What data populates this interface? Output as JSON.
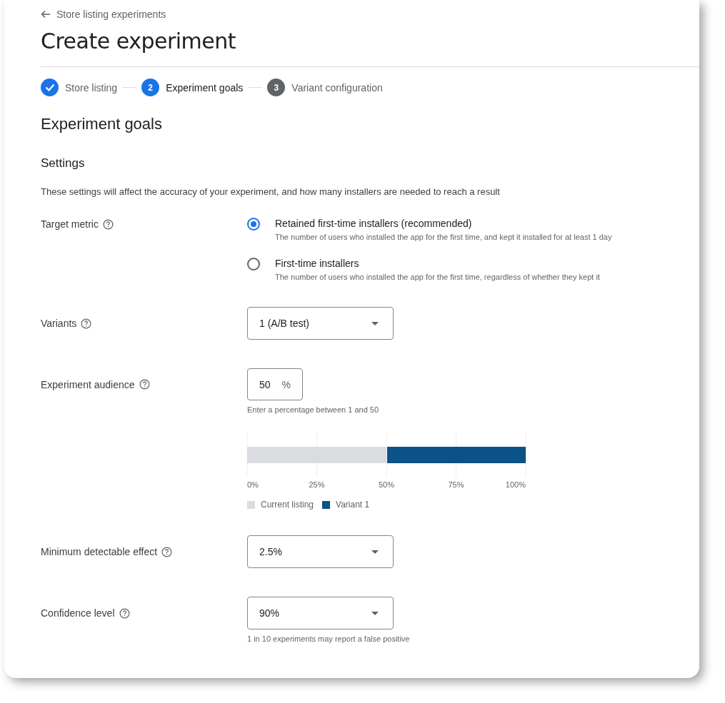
{
  "back_link": {
    "label": "Store listing experiments"
  },
  "title": "Create experiment",
  "stepper": [
    {
      "label": "Store listing",
      "completed": true,
      "selected": false
    },
    {
      "number": "2",
      "label": "Experiment goals",
      "completed": false,
      "selected": true
    },
    {
      "number": "3",
      "label": "Variant configuration",
      "completed": false,
      "selected": false
    }
  ],
  "section_title": "Experiment goals",
  "subsection_title": "Settings",
  "description": "These settings will affect the accuracy of your experiment, and how many installers are needed to reach a result",
  "target_metric": {
    "label": "Target metric",
    "options": [
      {
        "label": "Retained first-time installers (recommended)",
        "description": "The number of users who installed the app for the first time, and kept it installed for at least 1 day",
        "selected": true
      },
      {
        "label": "First-time installers",
        "description": "The number of users who installed the app for the first time, regardless of whether they kept it",
        "selected": false
      }
    ]
  },
  "variants": {
    "label": "Variants",
    "value": "1 (A/B test)"
  },
  "experiment_audience": {
    "label": "Experiment audience",
    "value": "50",
    "suffix": "%",
    "helper": "Enter a percentage between 1 and 50",
    "chart_data": {
      "type": "bar",
      "orientation": "horizontal",
      "stacked": true,
      "grid": true,
      "legend": true,
      "series": [
        {
          "name": "Current listing",
          "color": "#dadce0",
          "values": [
            50
          ]
        },
        {
          "name": "Variant 1",
          "color": "#0b5288",
          "values": [
            50
          ]
        }
      ],
      "xlim": [
        0,
        100
      ],
      "xticks": [
        {
          "value": 0,
          "label": "0%"
        },
        {
          "value": 25,
          "label": "25%"
        },
        {
          "value": 50,
          "label": "50%"
        },
        {
          "value": 75,
          "label": "75%"
        },
        {
          "value": 100,
          "label": "100%"
        }
      ]
    }
  },
  "minimum_detectable_effect": {
    "label": "Minimum detectable effect",
    "value": "2.5%"
  },
  "confidence_level": {
    "label": "Confidence level",
    "value": "90%",
    "helper": "1 in 10 experiments may report a false positive"
  }
}
